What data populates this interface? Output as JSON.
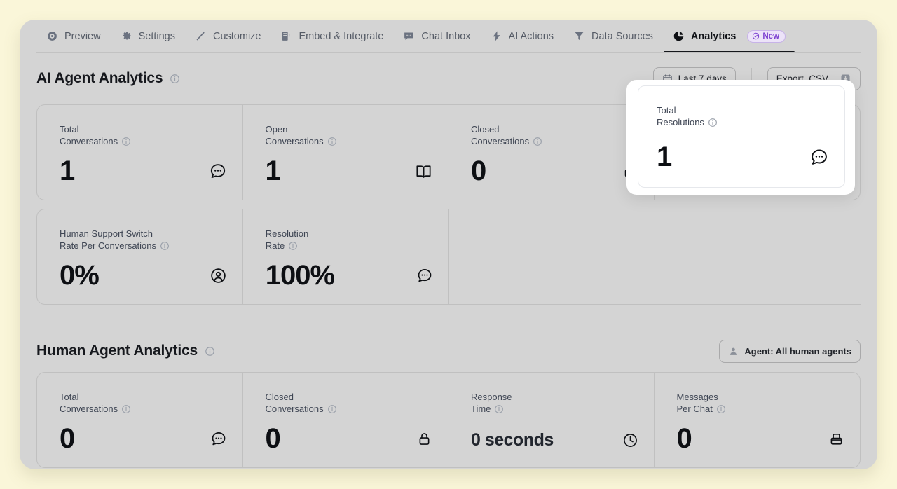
{
  "tabs": [
    {
      "label": "Preview",
      "icon": "eye-icon",
      "active": false
    },
    {
      "label": "Settings",
      "icon": "gear-icon",
      "active": false
    },
    {
      "label": "Customize",
      "icon": "pencil-icon",
      "active": false
    },
    {
      "label": "Embed & Integrate",
      "icon": "embed-icon",
      "active": false
    },
    {
      "label": "Chat Inbox",
      "icon": "chat-icon",
      "active": false
    },
    {
      "label": "AI Actions",
      "icon": "bolt-icon",
      "active": false
    },
    {
      "label": "Data Sources",
      "icon": "funnel-icon",
      "active": false
    },
    {
      "label": "Analytics",
      "icon": "pie-chart-icon",
      "active": true,
      "badge": "New",
      "badge_icon": "check-circle-icon"
    }
  ],
  "ai_section": {
    "title": "AI Agent Analytics",
    "info_icon": "info-icon",
    "date_filter": {
      "label": "Last 7 days",
      "icon": "calendar-icon"
    },
    "export": {
      "label": "Export .CSV",
      "icon": "download-icon"
    },
    "cards_row1": [
      {
        "label_line1": "Total",
        "label_line2": "Conversations",
        "value": "1",
        "icon": "chat-bubble-icon",
        "info_icon": "info-icon"
      },
      {
        "label_line1": "Open",
        "label_line2": "Conversations",
        "value": "1",
        "icon": "open-book-icon",
        "info_icon": "info-icon"
      },
      {
        "label_line1": "Closed",
        "label_line2": "Conversations",
        "value": "0",
        "icon": "lock-icon",
        "info_icon": "info-icon"
      },
      {
        "label_line1": "Total",
        "label_line2": "Resolutions",
        "value": "1",
        "icon": "chat-bubble-icon",
        "info_icon": "info-icon"
      }
    ],
    "cards_row2": [
      {
        "label_line1": "Human Support Switch",
        "label_line2": "Rate Per Conversations",
        "value": "0%",
        "icon": "user-circle-icon",
        "info_icon": "info-icon"
      },
      {
        "label_line1": "Resolution",
        "label_line2": "Rate",
        "value": "100%",
        "icon": "chat-bubble-icon",
        "info_icon": "info-icon"
      }
    ]
  },
  "spotlight": {
    "label_line1": "Total",
    "label_line2": "Resolutions",
    "value": "1",
    "icon": "chat-bubble-icon",
    "info_icon": "info-icon"
  },
  "human_section": {
    "title": "Human Agent Analytics",
    "info_icon": "info-icon",
    "agent_filter": {
      "label": "Agent: All human agents",
      "icon": "person-icon"
    },
    "cards": [
      {
        "label_line1": "Total",
        "label_line2": "Conversations",
        "value": "0",
        "icon": "chat-bubble-icon",
        "info_icon": "info-icon",
        "small": false
      },
      {
        "label_line1": "Closed",
        "label_line2": "Conversations",
        "value": "0",
        "icon": "lock-icon",
        "info_icon": "info-icon",
        "small": false
      },
      {
        "label_line1": "Response",
        "label_line2": "Time",
        "value": "0 seconds",
        "icon": "clock-icon",
        "info_icon": "info-icon",
        "small": true
      },
      {
        "label_line1": "Messages",
        "label_line2": "Per Chat",
        "value": "0",
        "icon": "inbox-icon",
        "info_icon": "info-icon",
        "small": false
      }
    ]
  },
  "colors": {
    "page_background": "#faf6d9",
    "panel_background": "#d4d4d4",
    "accent_badge": "#7b3fd0",
    "badge_background": "#ece3f8",
    "active_tab_underline": "#14161b",
    "label_text": "#3f4654",
    "value_text": "#0d0f13"
  }
}
